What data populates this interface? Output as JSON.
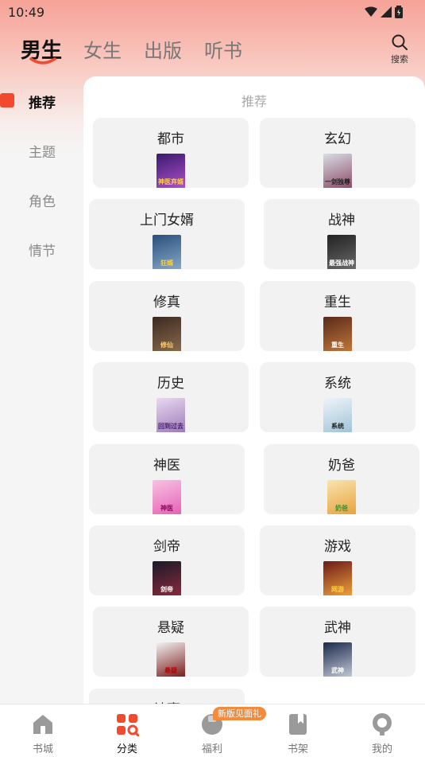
{
  "status": {
    "time": "10:49"
  },
  "header": {
    "tabs": [
      "男生",
      "女生",
      "出版",
      "听书"
    ],
    "search_label": "搜索"
  },
  "sidebar": {
    "items": [
      "推荐",
      "主题",
      "角色",
      "情节"
    ]
  },
  "panel": {
    "title": "推荐",
    "categories": [
      {
        "label": "都市",
        "cover_text": "神医弃婿",
        "cover_colors": [
          "#3a1b6b",
          "#b04fd1"
        ],
        "text_color": "#ffd23a"
      },
      {
        "label": "玄幻",
        "cover_text": "一剑独尊",
        "cover_colors": [
          "#d9dde6",
          "#8b4a66"
        ],
        "text_color": "#222"
      },
      {
        "label": "上门女婿",
        "cover_text": "狂婿",
        "cover_colors": [
          "#2a4f7a",
          "#86a9c9"
        ],
        "text_color": "#ffd23a"
      },
      {
        "label": "战神",
        "cover_text": "最强战神",
        "cover_colors": [
          "#222",
          "#6a6a6a"
        ],
        "text_color": "#fff"
      },
      {
        "label": "修真",
        "cover_text": "修仙",
        "cover_colors": [
          "#3b2a22",
          "#8a6a4a"
        ],
        "text_color": "#ffcf6a"
      },
      {
        "label": "重生",
        "cover_text": "重生",
        "cover_colors": [
          "#5a2a1a",
          "#c2773a"
        ],
        "text_color": "#fff"
      },
      {
        "label": "历史",
        "cover_text": "回到过去",
        "cover_colors": [
          "#e9d9f0",
          "#9a7ab8"
        ],
        "text_color": "#4a1e6a"
      },
      {
        "label": "系统",
        "cover_text": "系统",
        "cover_colors": [
          "#eef4f8",
          "#9fc3d8"
        ],
        "text_color": "#222"
      },
      {
        "label": "神医",
        "cover_text": "神医",
        "cover_colors": [
          "#f7c3e3",
          "#e65fb5"
        ],
        "text_color": "#8a0b5a"
      },
      {
        "label": "奶爸",
        "cover_text": "奶爸",
        "cover_colors": [
          "#fbe3b0",
          "#e6a23a"
        ],
        "text_color": "#2a9a3a"
      },
      {
        "label": "剑帝",
        "cover_text": "剑帝",
        "cover_colors": [
          "#1a1a2a",
          "#8a2a3a"
        ],
        "text_color": "#fff"
      },
      {
        "label": "游戏",
        "cover_text": "网游",
        "cover_colors": [
          "#6a1a1a",
          "#f0a23a"
        ],
        "text_color": "#ffd23a"
      },
      {
        "label": "悬疑",
        "cover_text": "悬疑",
        "cover_colors": [
          "#f2f2f2",
          "#7a1a1a"
        ],
        "text_color": "#b00"
      },
      {
        "label": "武神",
        "cover_text": "武神",
        "cover_colors": [
          "#1a2a4a",
          "#c3c9d8"
        ],
        "text_color": "#fff"
      },
      {
        "label": "神豪",
        "cover_text": "",
        "cover_colors": [
          "#f2f2f2",
          "#f2f2f2"
        ],
        "text_color": "#222"
      }
    ]
  },
  "bottom_nav": {
    "items": [
      "书城",
      "分类",
      "福利",
      "书架",
      "我的"
    ],
    "badge": "新版见面礼"
  },
  "colors": {
    "accent": "#f24a2e",
    "badge": "#f58a3a"
  }
}
